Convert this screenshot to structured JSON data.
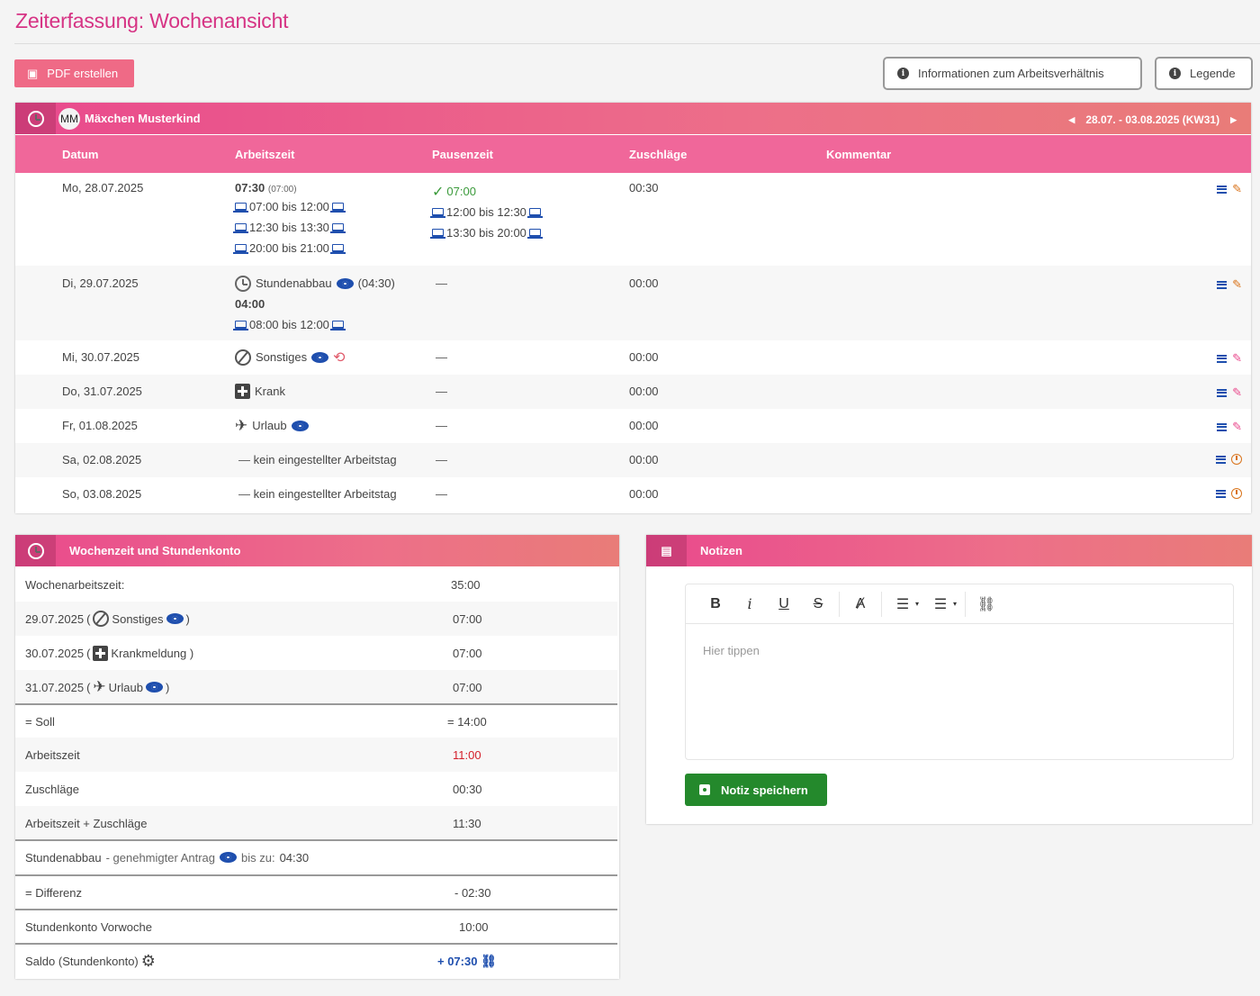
{
  "page": {
    "title": "Zeiterfassung: Wochenansicht"
  },
  "toolbar": {
    "pdf_label": "PDF erstellen",
    "info_label": "Informationen zum Arbeitsverhältnis",
    "legend_label": "Legende"
  },
  "week": {
    "avatar_initials": "MM",
    "employee_name": "Mäxchen Musterkind",
    "range_label": "28.07. - 03.08.2025 (KW31)",
    "columns": {
      "datum": "Datum",
      "arbeitszeit": "Arbeitszeit",
      "pausenzeit": "Pausenzeit",
      "zuschlaege": "Zuschläge",
      "kommentar": "Kommentar"
    },
    "rows": [
      {
        "date": "Mo, 28.07.2025",
        "work_total": "07:30",
        "work_total_small": "(07:00)",
        "work_spans": [
          "07:00 bis 12:00",
          "12:30 bis 13:30",
          "20:00 bis 21:00"
        ],
        "pause_total": "07:00",
        "pause_spans": [
          "12:00 bis 12:30",
          "13:30 bis 20:00"
        ],
        "surcharge": "00:30"
      },
      {
        "date": "Di, 29.07.2025",
        "type_label": "Stundenabbau",
        "type_extra": "(04:30)",
        "work_total": "04:00",
        "work_spans": [
          "08:00 bis 12:00"
        ],
        "pause": "—",
        "surcharge": "00:00"
      },
      {
        "date": "Mi, 30.07.2025",
        "type_label": "Sonstiges",
        "pause": "—",
        "surcharge": "00:00"
      },
      {
        "date": "Do, 31.07.2025",
        "type_label": "Krank",
        "pause": "—",
        "surcharge": "00:00"
      },
      {
        "date": "Fr, 01.08.2025",
        "type_label": "Urlaub",
        "pause": "—",
        "surcharge": "00:00"
      },
      {
        "date": "Sa, 02.08.2025",
        "type_dash": "—",
        "type_label": "kein eingestellter Arbeitstag",
        "pause": "—",
        "surcharge": "00:00"
      },
      {
        "date": "So, 03.08.2025",
        "type_dash": "—",
        "type_label": "kein eingestellter Arbeitstag",
        "pause": "—",
        "surcharge": "00:00"
      }
    ]
  },
  "summary": {
    "title": "Wochenzeit und Stundenkonto",
    "rows": [
      {
        "label": "Wochenarbeitszeit:",
        "value": "35:00"
      },
      {
        "date": "29.07.2025",
        "open": "(",
        "type": "Sonstiges",
        "close": ")",
        "value": "07:00"
      },
      {
        "date": "30.07.2025",
        "open": "(",
        "type": "Krankmeldung )",
        "value": "07:00"
      },
      {
        "date": "31.07.2025",
        "open": "(",
        "type": "Urlaub",
        "close": ")",
        "value": "07:00"
      },
      {
        "label": "= Soll",
        "value": "= 14:00"
      },
      {
        "label": "Arbeitszeit",
        "value": "11:00"
      },
      {
        "label": "Zuschläge",
        "value": "00:30"
      },
      {
        "label": "Arbeitszeit + Zuschläge",
        "value": "11:30"
      },
      {
        "label": "Stundenabbau",
        "label_suffix": "- genehmigter Antrag",
        "label_until": "bis zu:",
        "label_until_value": "04:30"
      },
      {
        "label": "= Differenz",
        "value": "- 02:30"
      },
      {
        "label": "Stundenkonto Vorwoche",
        "value": "10:00"
      },
      {
        "label": "Saldo (Stundenkonto)",
        "value": "+ 07:30"
      }
    ]
  },
  "notes": {
    "title": "Notizen",
    "placeholder": "Hier tippen",
    "save_label": "Notiz speichern"
  }
}
